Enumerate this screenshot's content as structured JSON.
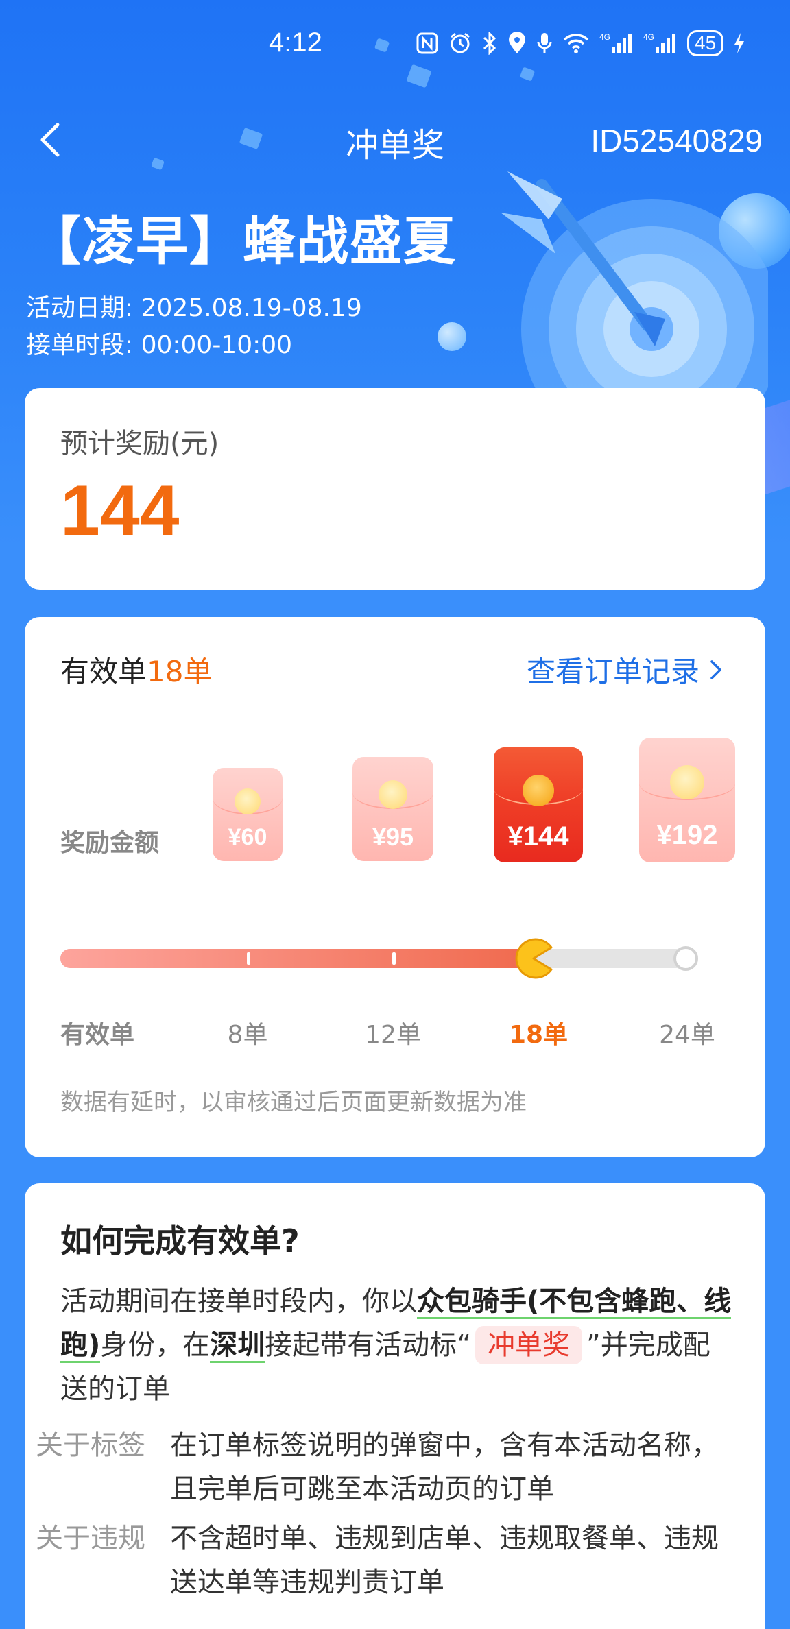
{
  "status_bar": {
    "time": "4:12",
    "signal_label_1": "4G",
    "signal_label_2": "4G",
    "battery": "45"
  },
  "nav": {
    "title": "冲单奖",
    "id_text": "ID52540829"
  },
  "activity": {
    "title": "【凌早】蜂战盛夏",
    "date_line": "活动日期: 2025.08.19-08.19",
    "time_line": "接单时段: 00:00-10:00"
  },
  "reward_card": {
    "label": "预计奖励(元)",
    "value": "144"
  },
  "progress_card": {
    "valid_prefix": "有效单",
    "valid_count": "18单",
    "view_orders": "查看订单记录",
    "reward_row_label": "奖励金额",
    "order_row_label": "有效单",
    "current_order_count": 18,
    "tiers": [
      {
        "amount": "¥60",
        "orders": "8单",
        "active": false
      },
      {
        "amount": "¥95",
        "orders": "12单",
        "active": false
      },
      {
        "amount": "¥144",
        "orders": "18单",
        "active": true
      },
      {
        "amount": "¥192",
        "orders": "24单",
        "active": false
      }
    ],
    "note": "数据有延时，以审核通过后页面更新数据为准"
  },
  "howto_card": {
    "title": "如何完成有效单?",
    "text_1": "活动期间在接单时段内，你以",
    "bold_1": "众包骑手(不包含蜂跑、线跑)",
    "text_2": "身份，在",
    "bold_2": "深圳",
    "text_3": "接起带有活动标“",
    "tag": "冲单奖",
    "text_4": "”并完成配送的订单",
    "rules": [
      {
        "key": "关于标签",
        "value": "在订单标签说明的弹窗中，含有本活动名称，且完单后可跳至本活动页的订单"
      },
      {
        "key": "关于违规",
        "value": "不含超时单、违规到店单、违规取餐单、违规送达单等违规判责订单"
      }
    ]
  },
  "colors": {
    "accent_orange": "#f26a0f",
    "brand_blue": "#1f73f5",
    "link_blue": "#1f6fe6",
    "red_envelope": "#e82a1f"
  },
  "icons": [
    "nfc-icon",
    "alarm-icon",
    "bluetooth-icon",
    "location-icon",
    "mic-icon",
    "wifi-icon",
    "signal-icon",
    "battery-icon",
    "charging-icon",
    "back-arrow-icon",
    "chevron-right-icon"
  ]
}
